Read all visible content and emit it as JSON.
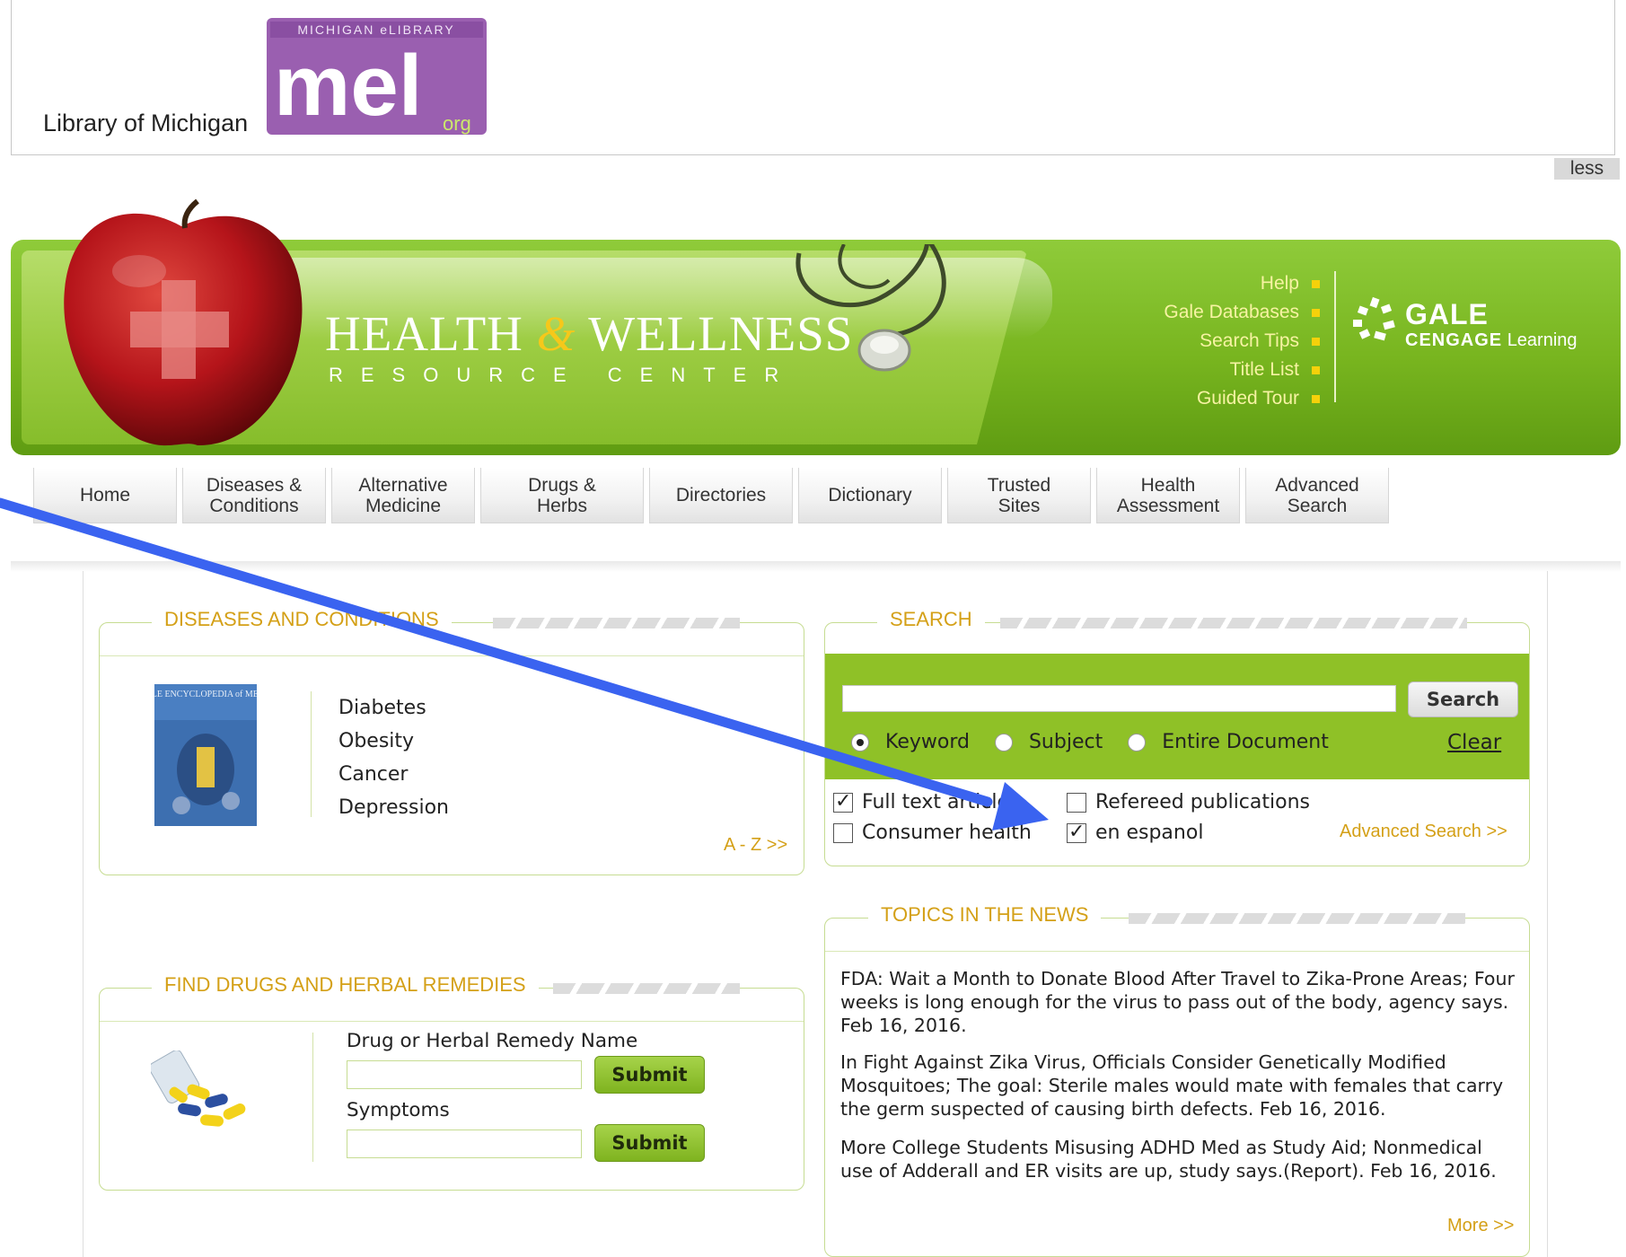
{
  "library": {
    "name": "Library of Michigan",
    "logo_top_text": "MICHIGAN eLIBRARY",
    "logo_letters": "mel",
    "logo_suffix": "org",
    "less_label": "less"
  },
  "banner": {
    "title_part1": "HEALTH",
    "title_amp": "&",
    "title_part2": "WELLNESS",
    "subtitle": "RESOURCE CENTER",
    "links": [
      "Help",
      "Gale Databases",
      "Search Tips",
      "Title List",
      "Guided Tour"
    ],
    "gale": "GALE",
    "cengage": "CENGAGE",
    "learning": "Learning"
  },
  "nav": {
    "tabs": [
      {
        "line1": "Home",
        "line2": ""
      },
      {
        "line1": "Diseases &",
        "line2": "Conditions"
      },
      {
        "line1": "Alternative",
        "line2": "Medicine"
      },
      {
        "line1": "Drugs &",
        "line2": "Herbs"
      },
      {
        "line1": "Directories",
        "line2": ""
      },
      {
        "line1": "Dictionary",
        "line2": ""
      },
      {
        "line1": "Trusted",
        "line2": "Sites"
      },
      {
        "line1": "Health",
        "line2": "Assessment"
      },
      {
        "line1": "Advanced",
        "line2": "Search"
      }
    ]
  },
  "diseases": {
    "title": "DISEASES AND CONDITIONS",
    "book_title": "The GALE ENCYCLOPEDIA of MEDICINE",
    "items": [
      "Diabetes",
      "Obesity",
      "Cancer",
      "Depression"
    ],
    "az_link": "A - Z >>"
  },
  "search": {
    "title": "SEARCH",
    "input_value": "",
    "button": "Search",
    "radios": [
      {
        "label": "Keyword",
        "checked": true
      },
      {
        "label": "Subject",
        "checked": false
      },
      {
        "label": "Entire Document",
        "checked": false
      }
    ],
    "clear": "Clear",
    "checkboxes": [
      {
        "label": "Full text articles",
        "checked": true
      },
      {
        "label": "Refereed publications",
        "checked": false
      },
      {
        "label": "Consumer health",
        "checked": false
      },
      {
        "label": "en espanol",
        "checked": true
      }
    ],
    "advanced_link": "Advanced Search >>"
  },
  "topics": {
    "title": "TOPICS IN THE NEWS",
    "items": [
      "FDA: Wait a Month to Donate Blood After Travel to Zika-Prone Areas; Four weeks is long enough for the virus to pass out of the body, agency says. Feb 16, 2016.",
      "In Fight Against Zika Virus, Officials Consider Genetically Modified Mosquitoes; The goal: Sterile males would mate with females that carry the germ suspected of causing birth defects. Feb 16, 2016.",
      "More College Students Misusing ADHD Med as Study Aid; Nonmedical use of Adderall and ER visits are up, study says.(Report). Feb 16, 2016."
    ],
    "more_link": "More >>"
  },
  "drugs": {
    "title": "FIND DRUGS AND HERBAL REMEDIES",
    "name_label": "Drug or Herbal Remedy Name",
    "name_value": "",
    "symptoms_label": "Symptoms",
    "symptoms_value": "",
    "submit": "Submit"
  },
  "colors": {
    "banner_green": "#78b51f",
    "search_green": "#8fc127",
    "gold": "#d4a017",
    "arrow_blue": "#3a63f0"
  }
}
